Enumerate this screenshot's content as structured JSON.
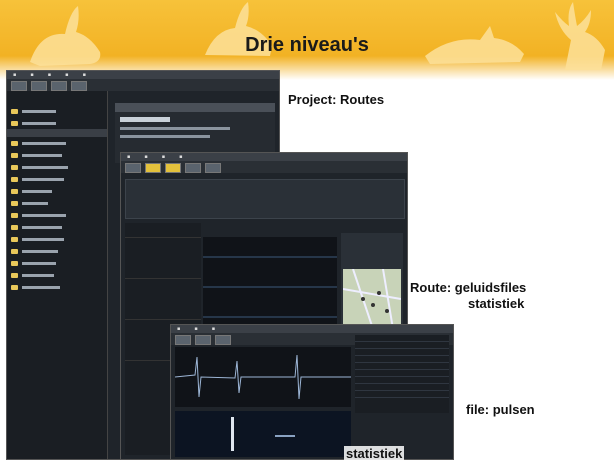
{
  "slide": {
    "title": "Drie niveau's",
    "captions": {
      "project": "Project: Routes",
      "route_line1": "Route: geluidsfiles",
      "route_line2": "statistiek",
      "file": "file: pulsen",
      "stats": "statistiek"
    }
  },
  "colors": {
    "header": "#f2b224",
    "app_background": "#1f242a"
  },
  "icons": [
    "hare-silhouette",
    "deer-silhouette",
    "folder-icon"
  ]
}
